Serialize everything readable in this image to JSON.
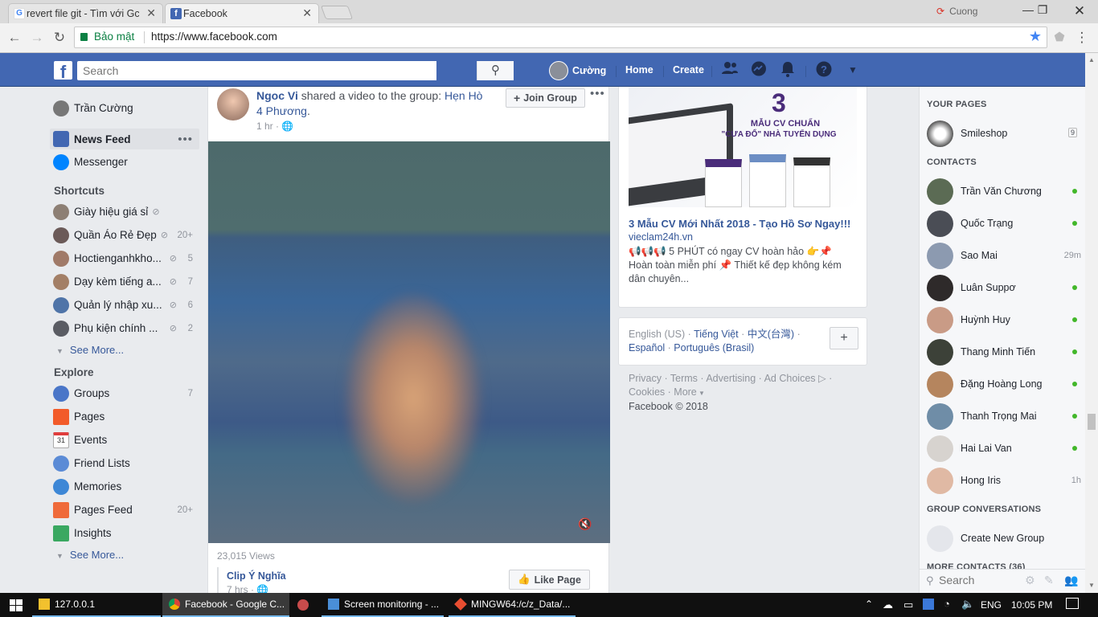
{
  "browser": {
    "tabs": [
      {
        "title": "revert file git - Tìm với Gc",
        "active": false
      },
      {
        "title": "Facebook",
        "active": true
      }
    ],
    "profile_name": "Cuong",
    "secure_label": "Bảo mật",
    "url": "https://www.facebook.com"
  },
  "fb_header": {
    "search_placeholder": "Search",
    "user_name": "Cường",
    "home_label": "Home",
    "create_label": "Create",
    "brand_color": "#4267b2"
  },
  "left_nav": {
    "profile_name": "Trần Cường",
    "news_feed": "News Feed",
    "messenger": "Messenger",
    "shortcuts_heading": "Shortcuts",
    "shortcuts": [
      {
        "label": "Giày hiệu giá sỉ",
        "count": ""
      },
      {
        "label": "Quần Áo Rẻ Đẹp",
        "count": "20+"
      },
      {
        "label": "Hoctienganhkho...",
        "count": "5"
      },
      {
        "label": "Dạy kèm tiếng a...",
        "count": "7"
      },
      {
        "label": "Quản lý nhập xu...",
        "count": "6"
      },
      {
        "label": "Phụ kiện chính ...",
        "count": "2"
      }
    ],
    "see_more": "See More...",
    "explore_heading": "Explore",
    "explore": [
      {
        "label": "Groups",
        "count": "7",
        "icon": "groups-icon"
      },
      {
        "label": "Pages",
        "count": "",
        "icon": "pages-flag-icon"
      },
      {
        "label": "Events",
        "count": "",
        "icon": "calendar-icon",
        "icon_text": "31"
      },
      {
        "label": "Friend Lists",
        "count": "",
        "icon": "friend-lists-icon"
      },
      {
        "label": "Memories",
        "count": "",
        "icon": "memories-clock-icon"
      },
      {
        "label": "Pages Feed",
        "count": "20+",
        "icon": "pages-feed-icon"
      },
      {
        "label": "Insights",
        "count": "",
        "icon": "insights-cube-icon"
      }
    ]
  },
  "post": {
    "author": "Ngoc Vi",
    "action_text": " shared a video to the group: ",
    "group_name": "Hẹn Hò 4 Phương",
    "time": "1 hr · ",
    "join_label": "Join Group",
    "views": "23,015 Views",
    "page_name": "Clip Ý Nghĩa",
    "page_time": "7 hrs · ",
    "like_page_label": "Like Page"
  },
  "ad": {
    "image_big_num": "3",
    "image_line1": "MẪU CV CHUẨN",
    "image_line2": "\"CƯA ĐỔ\" NHÀ TUYỂN DỤNG",
    "title": "3 Mẫu CV Mới Nhất 2018 - Tạo Hồ Sơ Ngay!!!",
    "domain": "vieclam24h.vn",
    "body_line1": "📢📢📢 5 PHÚT có ngay CV hoàn hảo 👉📌",
    "body_line2": "Hoàn toàn miễn phí 📌 Thiết kế đẹp không kém",
    "body_line3": "dân chuyên..."
  },
  "languages": {
    "current": "English (US)",
    "sep": " · ",
    "lang_vi": "Tiếng Việt",
    "lang_zh": "中文(台灣)",
    "lang_es": "Español",
    "lang_pt": "Português (Brasil)",
    "add_label": "+"
  },
  "footer": {
    "privacy": "Privacy",
    "terms": "Terms",
    "advertising": "Advertising",
    "ad_choices": "Ad Choices",
    "cookies": "Cookies",
    "more": "More",
    "copyright": "Facebook © 2018"
  },
  "right_sidebar": {
    "your_pages_heading": "YOUR PAGES",
    "page_name": "Smileshop",
    "page_count": "9",
    "contacts_heading": "CONTACTS",
    "contacts": [
      {
        "name": "Trần Văn Chương",
        "status": "online",
        "time": ""
      },
      {
        "name": "Quốc Trạng",
        "status": "online",
        "time": ""
      },
      {
        "name": "Sao Mai",
        "status": "away",
        "time": "29m"
      },
      {
        "name": "Luân Suppơ",
        "status": "online",
        "time": ""
      },
      {
        "name": "Huỳnh Huy",
        "status": "online",
        "time": ""
      },
      {
        "name": "Thang Minh Tiến",
        "status": "online",
        "time": ""
      },
      {
        "name": "Đặng Hoàng Long",
        "status": "online",
        "time": ""
      },
      {
        "name": "Thanh Trọng Mai",
        "status": "online",
        "time": ""
      },
      {
        "name": "Hai Lai Van",
        "status": "online",
        "time": ""
      },
      {
        "name": "Hong Iris",
        "status": "away",
        "time": "1h"
      }
    ],
    "group_conv_heading": "GROUP CONVERSATIONS",
    "create_group": "Create New Group",
    "more_contacts": "MORE CONTACTS (36)",
    "search_placeholder": "Search"
  },
  "taskbar": {
    "items": [
      {
        "label": "127.0.0.1",
        "icon": "folder-icon"
      },
      {
        "label": "Facebook - Google C...",
        "icon": "chrome-icon"
      },
      {
        "label": "",
        "icon": "paint-icon"
      },
      {
        "label": "Screen monitoring - ...",
        "icon": "cube-app-icon"
      },
      {
        "label": "MINGW64:/c/z_Data/...",
        "icon": "git-icon"
      }
    ],
    "lang": "ENG",
    "time": "10:05 PM"
  }
}
